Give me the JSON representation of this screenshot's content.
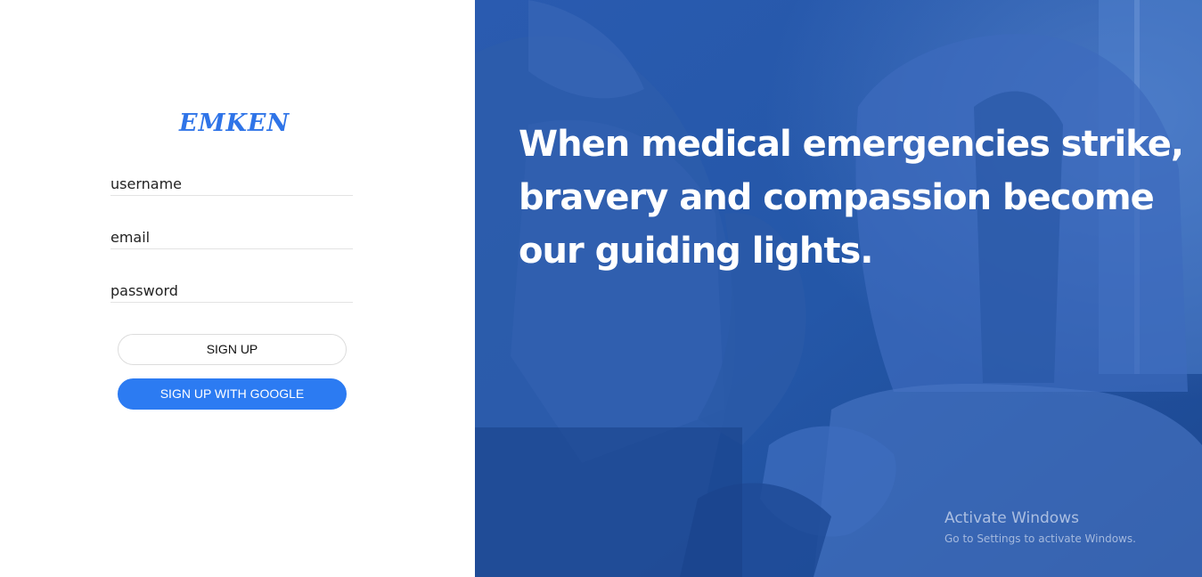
{
  "brand": {
    "logo_text": "EMKEN",
    "accent_color": "#2f74e8"
  },
  "form": {
    "username": {
      "placeholder": "username",
      "value": ""
    },
    "email": {
      "placeholder": "email",
      "value": ""
    },
    "password": {
      "placeholder": "password",
      "value": ""
    },
    "signup_label": "SIGN UP",
    "google_label": "SIGN UP WITH GOOGLE",
    "google_button_color": "#2c7bf2"
  },
  "hero": {
    "headline": "When medical emergencies strike, bravery and compassion become our guiding lights.",
    "overlay_color": "#1f4fa0"
  },
  "system": {
    "watermark_title": "Activate Windows",
    "watermark_subtitle": "Go to Settings to activate Windows."
  }
}
